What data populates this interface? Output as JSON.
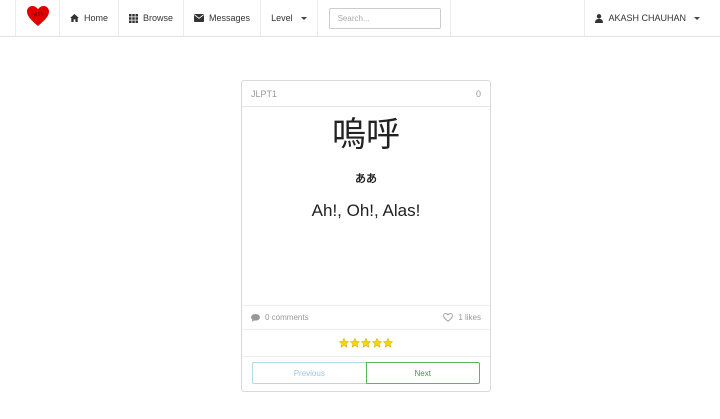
{
  "navbar": {
    "brand_icon": "heart-logo-icon",
    "home_label": "Home",
    "browse_label": "Browse",
    "messages_label": "Messages",
    "level_label": "Level",
    "search_placeholder": "Search...",
    "user_name": "AKASH CHAUHAN"
  },
  "card": {
    "level": "JLPT1",
    "count": "0",
    "kanji": "嗚呼",
    "reading": "ああ",
    "meaning": "Ah!, Oh!, Alas!",
    "comments": "0 comments",
    "likes": "1 likes",
    "rating_stars": 5,
    "prev_label": "Previous",
    "next_label": "Next"
  },
  "colors": {
    "logo_red": "#e00000",
    "star_yellow": "#f5d50c",
    "next_green": "#5cb85c",
    "prev_blue": "#b9d7ea"
  }
}
